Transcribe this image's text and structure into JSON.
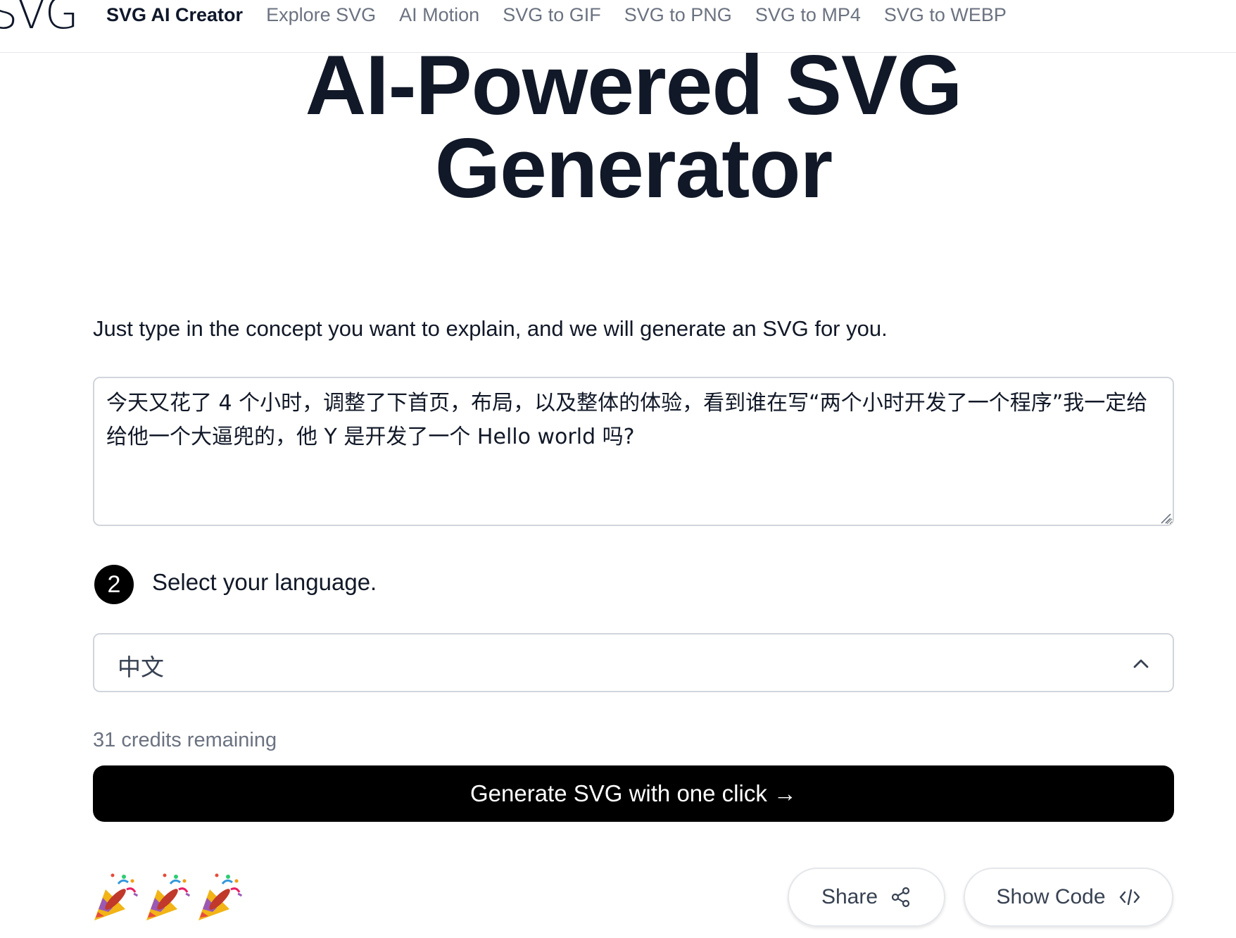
{
  "nav": {
    "logo": "SVG",
    "links": [
      {
        "label": "SVG AI Creator",
        "active": true
      },
      {
        "label": "Explore SVG"
      },
      {
        "label": "AI Motion"
      },
      {
        "label": "SVG to GIF"
      },
      {
        "label": "SVG to PNG"
      },
      {
        "label": "SVG to MP4"
      },
      {
        "label": "SVG to WEBP"
      }
    ]
  },
  "hero": {
    "title_line1": "AI-Powered SVG",
    "title_line2": "Generator"
  },
  "form": {
    "intro": "Just type in the concept you want to explain, and we will generate an SVG for you.",
    "concept_value": "今天又花了 4 个小时，调整了下首页，布局，以及整体的体验，看到谁在写“两个小时开发了一个程序”我一定给给他一个大逼兜的，他 Y 是开发了一个 Hello world 吗?",
    "step_number": "2",
    "step_label": "Select your language.",
    "language_selected": "中文",
    "credits": "31 credits remaining",
    "generate_label": "Generate SVG with one click →"
  },
  "actions": {
    "share_label": "Share",
    "show_code_label": "Show Code"
  },
  "icons": {
    "dropdown": "chevron-up-icon",
    "share": "share-icon",
    "code": "code-icon",
    "celebrate": "party-popper-icon"
  },
  "colors": {
    "primary_button": "#000000",
    "muted_text": "#6b7280",
    "heading": "#111827",
    "border": "#d1d5db"
  }
}
